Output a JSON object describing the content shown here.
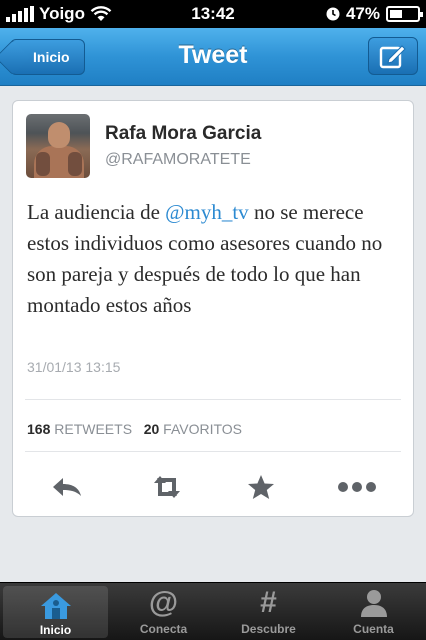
{
  "status_bar": {
    "carrier": "Yoigo",
    "time": "13:42",
    "battery": "47%",
    "battery_level": 0.47
  },
  "nav": {
    "title": "Tweet",
    "back_label": "Inicio"
  },
  "tweet": {
    "name": "Rafa Mora Garcia",
    "handle": "@RAFAMORATETE",
    "text_before": "La audiencia de ",
    "mention": "@myh_tv",
    "text_after": " no se merece estos individuos como asesores cuando no son pareja y después de todo lo que han montado estos años",
    "timestamp": "31/01/13 13:15",
    "retweets_count": "168",
    "retweets_label": "RETWEETS",
    "favorites_count": "20",
    "favorites_label": "FAVORITOS"
  },
  "tabs": [
    {
      "label": "Inicio",
      "icon": "home-icon"
    },
    {
      "label": "Conecta",
      "icon": "at-icon"
    },
    {
      "label": "Descubre",
      "icon": "hash-icon"
    },
    {
      "label": "Cuenta",
      "icon": "person-icon"
    }
  ],
  "colors": {
    "accent": "#2f93d6",
    "mention": "#2c8ad1",
    "tab_active": "#3a9ae0"
  }
}
